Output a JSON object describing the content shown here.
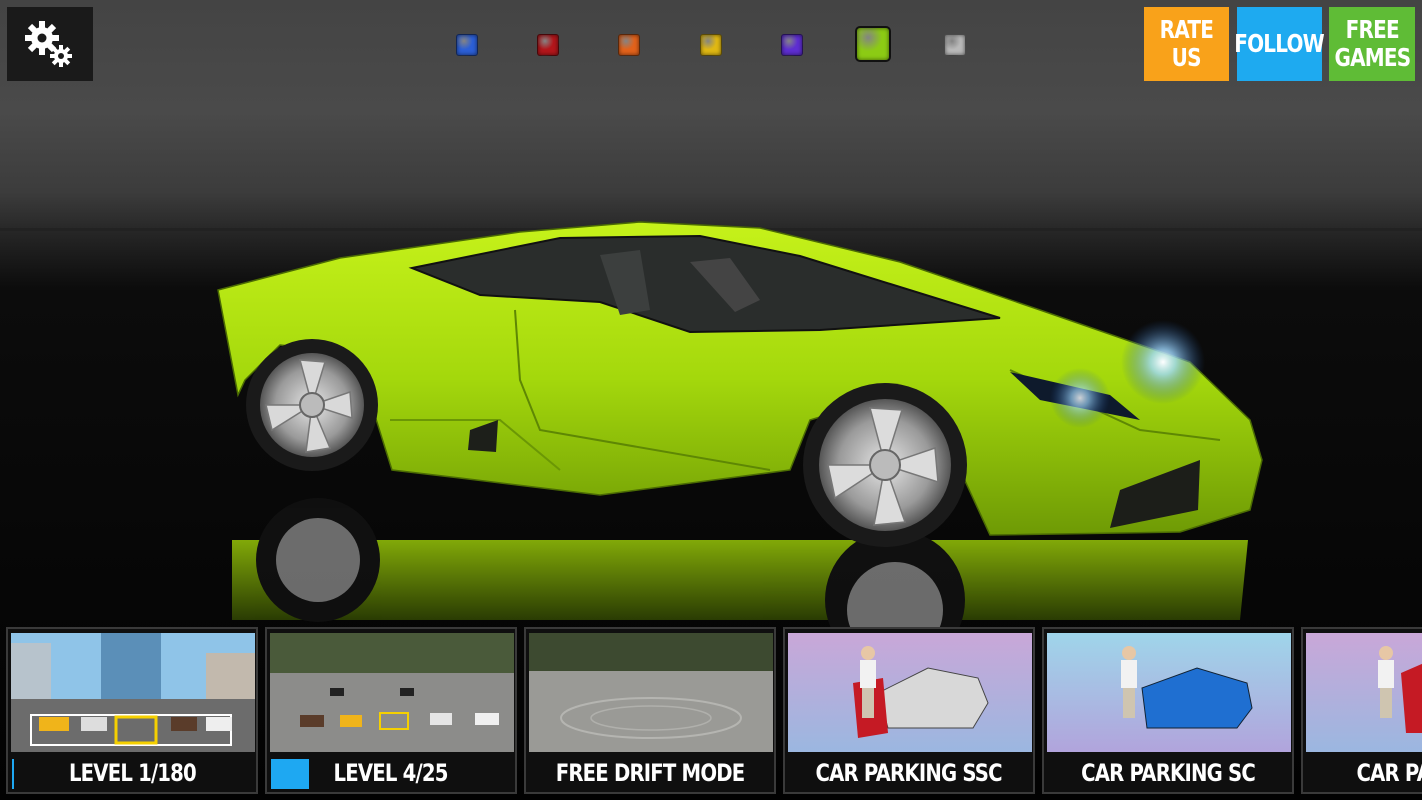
{
  "settings": {
    "icon": "gears-icon"
  },
  "color_swatches": [
    {
      "name": "blue",
      "color": "#2c5fd6"
    },
    {
      "name": "red",
      "color": "#b3161b"
    },
    {
      "name": "orange",
      "color": "#e2621b"
    },
    {
      "name": "yellow",
      "color": "#e0b813"
    },
    {
      "name": "purple",
      "color": "#5e2ed1"
    },
    {
      "name": "lime",
      "color": "#8ccb14",
      "selected": true
    },
    {
      "name": "silver",
      "color": "#b9b9b9"
    }
  ],
  "top_buttons": {
    "rate": {
      "line1": "RATE",
      "line2": "US",
      "color": "#f9a21a"
    },
    "follow": {
      "label": "FOLLOW",
      "color": "#1eaaf0"
    },
    "free_games": {
      "line1": "FREE",
      "line2": "GAMES",
      "color": "#5fbc36"
    }
  },
  "car": {
    "color": "#a9df0c"
  },
  "modes": [
    {
      "label": "LEVEL 1/180"
    },
    {
      "label": "LEVEL 4/25"
    },
    {
      "label": "FREE DRIFT MODE"
    },
    {
      "label": "CAR PARKING SSC"
    },
    {
      "label": "CAR PARKING SC"
    },
    {
      "label": "CAR PARKING"
    }
  ]
}
